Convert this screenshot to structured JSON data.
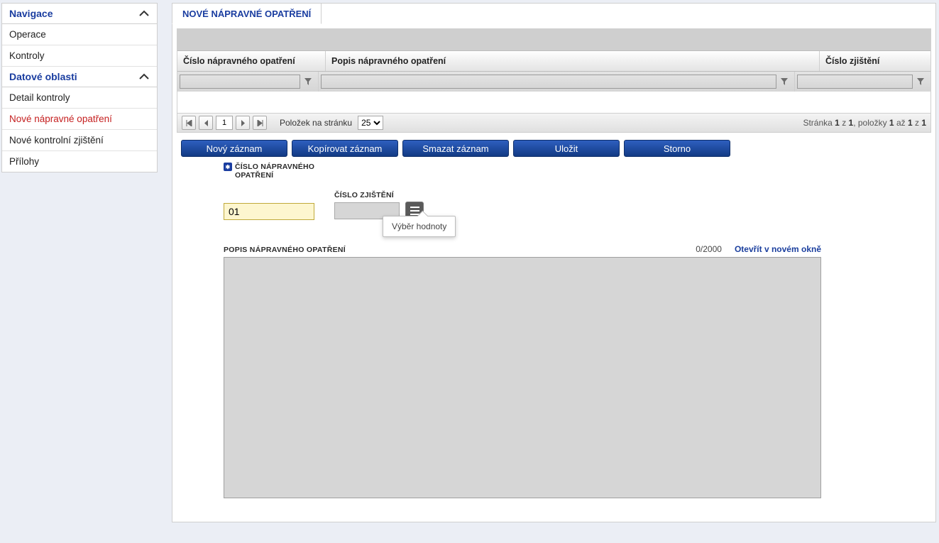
{
  "sidebar": {
    "nav_title": "Navigace",
    "nav_items": [
      "Operace",
      "Kontroly"
    ],
    "data_title": "Datové oblasti",
    "data_items": [
      {
        "label": "Detail kontroly",
        "active": false
      },
      {
        "label": "Nové nápravné opatření",
        "active": true
      },
      {
        "label": "Nové kontrolní zjištění",
        "active": false
      },
      {
        "label": "Přílohy",
        "active": false
      }
    ]
  },
  "tab": {
    "label": "NOVÉ NÁPRAVNÉ OPATŘENÍ"
  },
  "grid": {
    "columns": {
      "a": "Číslo nápravného opatření",
      "b": "Popis nápravného opatření",
      "c": "Číslo zjištění"
    }
  },
  "pager": {
    "page_value": "1",
    "per_page_label": "Položek na stránku",
    "per_page_value": "25",
    "summary_a": "Stránka ",
    "summary_b": "1",
    "summary_c": " z ",
    "summary_d": "1",
    "summary_e": ", položky ",
    "summary_f": "1",
    "summary_g": " až ",
    "summary_h": "1",
    "summary_i": " z ",
    "summary_j": "1"
  },
  "actions": {
    "new": "Nový záznam",
    "copy": "Kopírovat záznam",
    "delete": "Smazat záznam",
    "save": "Uložit",
    "cancel": "Storno"
  },
  "form": {
    "num_label_a": "ČÍSLO NÁPRAVNÉHO",
    "num_label_b": "OPATŘENÍ",
    "num_value": "01",
    "zjisteni_label": "ČÍSLO ZJIŠTĚNÍ",
    "zjisteni_value": "",
    "tooltip": "Výběr hodnoty",
    "popis_label": "POPIS NÁPRAVNÉHO OPATŘENÍ",
    "popis_counter": "0/2000",
    "popis_link": "Otevřít v novém okně",
    "popis_value": ""
  }
}
